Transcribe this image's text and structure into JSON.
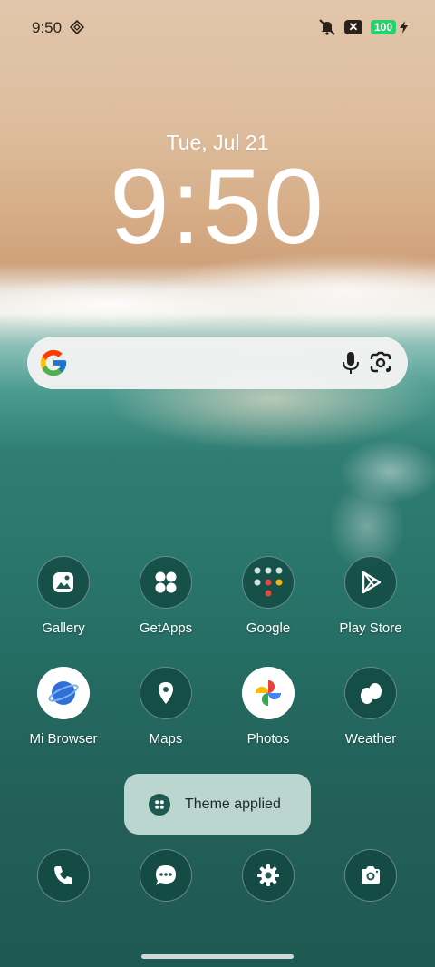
{
  "status_bar": {
    "time": "9:50",
    "battery": "100",
    "icons": [
      "mode-diamond-icon",
      "mute-vibrate-icon",
      "x-badge-icon",
      "battery-icon",
      "charging-bolt-icon"
    ]
  },
  "lock_widget": {
    "date": "Tue, Jul 21",
    "time": "9:50"
  },
  "search_bar": {
    "icons": [
      "google-g-icon",
      "microphone-icon",
      "google-lens-icon"
    ]
  },
  "apps_row1": [
    {
      "label": "Gallery",
      "icon": "gallery-icon"
    },
    {
      "label": "GetApps",
      "icon": "getapps-icon"
    },
    {
      "label": "Google",
      "icon": "google-folder-icon"
    },
    {
      "label": "Play Store",
      "icon": "play-store-icon"
    }
  ],
  "apps_row2": [
    {
      "label": "Mi Browser",
      "icon": "mi-browser-icon"
    },
    {
      "label": "Maps",
      "icon": "maps-icon"
    },
    {
      "label": "Photos",
      "icon": "photos-icon"
    },
    {
      "label": "Weather",
      "icon": "weather-icon"
    }
  ],
  "toast": {
    "text": "Theme applied",
    "icon": "theme-icon"
  },
  "dock": [
    "phone-icon",
    "messages-icon",
    "settings-icon",
    "camera-icon"
  ],
  "colors": {
    "icon_bg": "#1f5a52",
    "toast_bg": "#c4dcd6",
    "battery": "#25d26b"
  }
}
